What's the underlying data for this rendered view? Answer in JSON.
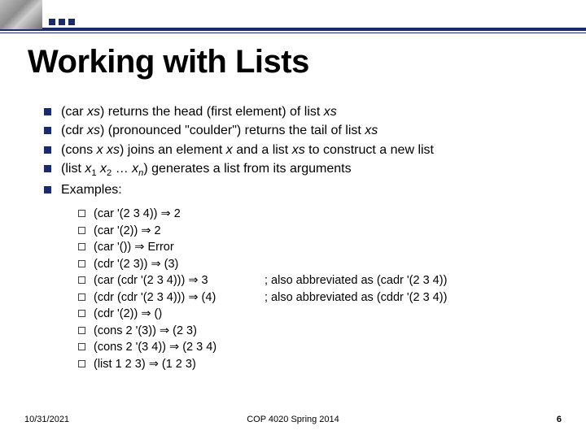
{
  "title": "Working with Lists",
  "bullets": [
    "(car <i>xs</i>) returns the head (first element) of list <i>xs</i>",
    "(cdr <i>xs</i>) (pronounced \"coulder\") returns the tail of list <i>xs</i>",
    "(cons <i>x xs</i>) joins an element <i>x</i> and a list <i>xs</i> to construct a new list",
    "(list <i>x</i><sub>1</sub> <i>x</i><sub>2</sub> &hellip; <i>x<sub>n</sub></i>) generates a list from its arguments",
    "Examples:"
  ],
  "examples": [
    {
      "expr": "(car '(2 3 4)) ⇒ 2",
      "comment": ""
    },
    {
      "expr": "(car '(2)) ⇒ 2",
      "comment": ""
    },
    {
      "expr": "(car '()) ⇒ Error",
      "comment": ""
    },
    {
      "expr": "(cdr '(2 3)) ⇒ (3)",
      "comment": ""
    },
    {
      "expr": "(car (cdr '(2 3 4))) ⇒ 3",
      "comment": "; also abbreviated as (cadr '(2 3 4))"
    },
    {
      "expr": "(cdr (cdr '(2 3 4))) ⇒ (4)",
      "comment": "; also abbreviated as (cddr '(2 3 4))"
    },
    {
      "expr": "(cdr '(2)) ⇒ ()",
      "comment": ""
    },
    {
      "expr": "(cons 2 '(3)) ⇒ (2 3)",
      "comment": ""
    },
    {
      "expr": "(cons 2 '(3 4)) ⇒ (2 3 4)",
      "comment": ""
    },
    {
      "expr": "(list 1 2 3) ⇒ (1 2 3)",
      "comment": ""
    }
  ],
  "footer": {
    "date": "10/31/2021",
    "course": "COP 4020 Spring 2014",
    "page": "6"
  }
}
